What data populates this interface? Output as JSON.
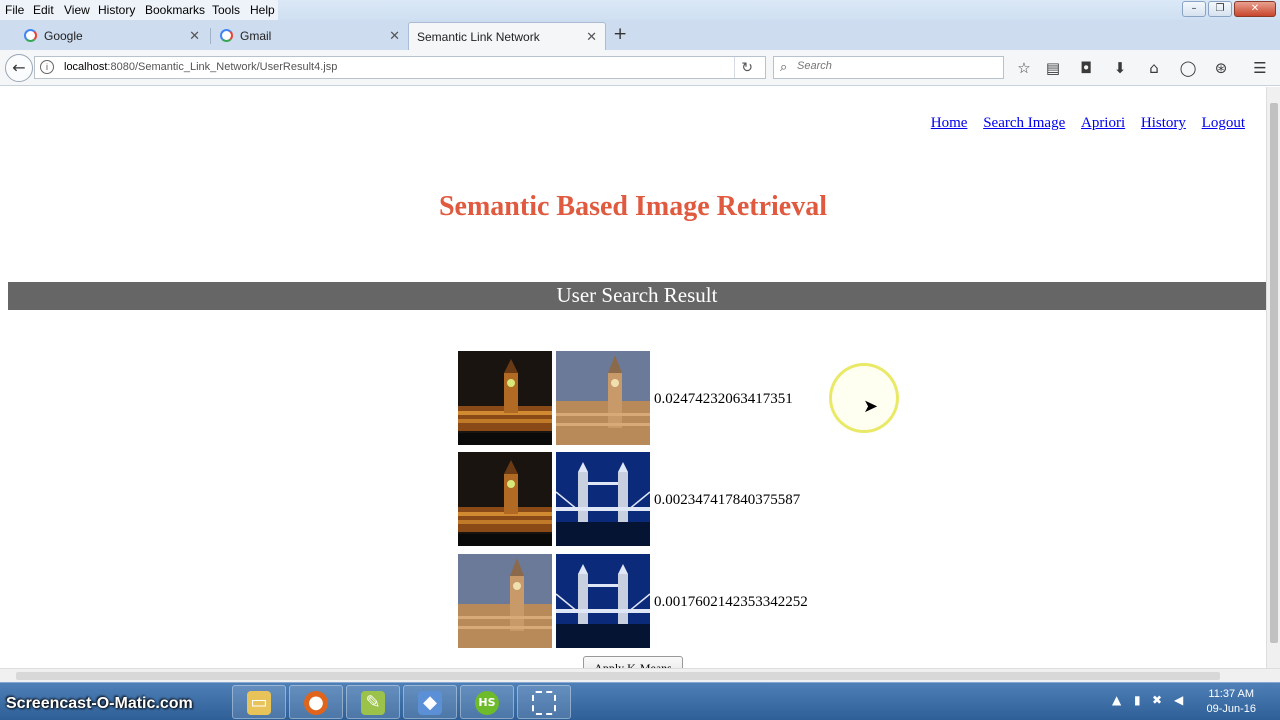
{
  "menu": [
    "File",
    "Edit",
    "View",
    "History",
    "Bookmarks",
    "Tools",
    "Help"
  ],
  "tabs": [
    {
      "label": "Google",
      "active": false
    },
    {
      "label": "Gmail",
      "active": false
    },
    {
      "label": "Semantic Link Network",
      "active": true
    }
  ],
  "url": {
    "host": "localhost",
    "path": ":8080/Semantic_Link_Network/UserResult4.jsp"
  },
  "search": {
    "placeholder": "Search"
  },
  "nav_links": [
    "Home",
    "Search Image",
    "Apriori",
    "History",
    "Logout"
  ],
  "page_title": "Semantic Based Image Retrieval",
  "section_title": "User Search Result",
  "results": [
    {
      "image_a": "big-ben-night",
      "image_b": "big-ben-dusk",
      "score": "0.02474232063417351"
    },
    {
      "image_a": "big-ben-night",
      "image_b": "tower-bridge-night",
      "score": "0.002347417840375587"
    },
    {
      "image_a": "big-ben-dusk",
      "image_b": "tower-bridge-night",
      "score": "0.0017602142353342252"
    }
  ],
  "kmeans_button": "Apply K-Means",
  "watermark": "Screencast-O-Matic.com",
  "clock": {
    "time": "11:37 AM",
    "date": "09-Jun-16"
  },
  "colors": {
    "title": "#e05a3f",
    "section_bar": "#666666",
    "link": "#0000ee"
  }
}
